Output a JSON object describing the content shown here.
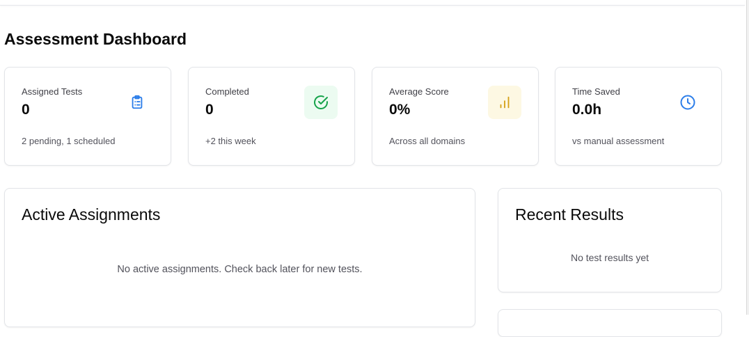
{
  "header": {
    "title": "Assessment Dashboard"
  },
  "stats": [
    {
      "label": "Assigned Tests",
      "value": "0",
      "sub": "2 pending, 1 scheduled",
      "icon": "clipboard-icon",
      "icon_color": "#2b7de9",
      "icon_bg": "#ffffff"
    },
    {
      "label": "Completed",
      "value": "0",
      "sub": "+2 this week",
      "icon": "check-circle-icon",
      "icon_color": "#16a34a",
      "icon_bg": "#ecfbf1"
    },
    {
      "label": "Average Score",
      "value": "0%",
      "sub": "Across all domains",
      "icon": "bar-chart-icon",
      "icon_color": "#d4a017",
      "icon_bg": "#fdf8e3"
    },
    {
      "label": "Time Saved",
      "value": "0.0h",
      "sub": "vs manual assessment",
      "icon": "clock-icon",
      "icon_color": "#2b7de9",
      "icon_bg": "#ffffff"
    }
  ],
  "active_assignments": {
    "title": "Active Assignments",
    "empty": "No active assignments. Check back later for new tests."
  },
  "recent_results": {
    "title": "Recent Results",
    "empty": "No test results yet"
  }
}
